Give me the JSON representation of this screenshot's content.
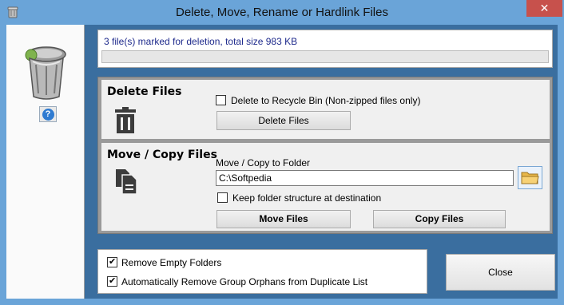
{
  "window": {
    "title": "Delete, Move, Rename or Hardlink Files",
    "close_glyph": "✕"
  },
  "sidebar": {
    "help_glyph": "?"
  },
  "status": {
    "text": "3 file(s) marked for deletion, total size 983 KB",
    "progress_percent": 0,
    "progress_color": "#37a64a"
  },
  "delete_section": {
    "title": "Delete Files",
    "recycle_checkbox_label": "Delete to Recycle Bin (Non-zipped files only)",
    "recycle_checked": false,
    "button_label": "Delete Files"
  },
  "move_section": {
    "title": "Move / Copy Files",
    "folder_label": "Move / Copy to Folder",
    "folder_value": "C:\\Softpedia",
    "keep_structure_label": "Keep folder structure at destination",
    "keep_structure_checked": false,
    "move_button_label": "Move Files",
    "copy_button_label": "Copy Files"
  },
  "options": {
    "remove_empty_label": "Remove Empty Folders",
    "remove_empty_checked": true,
    "remove_orphans_label": "Automatically Remove Group Orphans from Duplicate List",
    "remove_orphans_checked": true
  },
  "close_button_label": "Close",
  "colors": {
    "window_frame": "#6aa4d8",
    "client_background": "#3a6e9f",
    "status_text": "#1e2a8c",
    "close_x": "#c7514c"
  }
}
